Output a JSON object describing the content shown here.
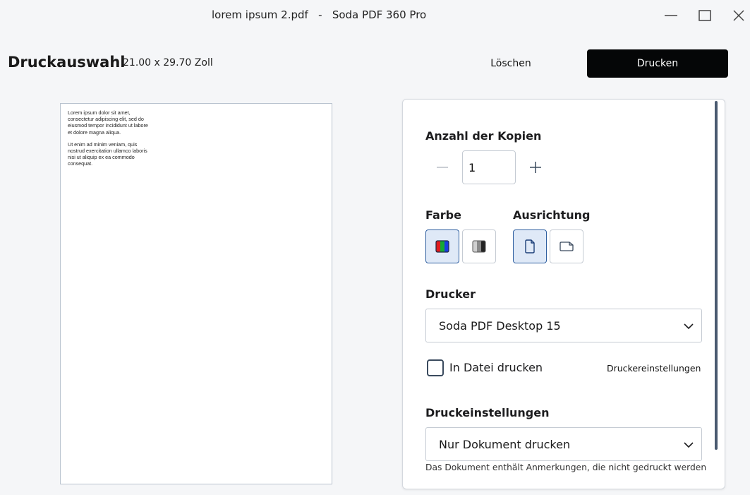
{
  "window": {
    "title": "lorem ipsum 2.pdf   -   Soda PDF 360 Pro",
    "minimize_icon": "minimize-icon",
    "maximize_icon": "maximize-icon",
    "close_icon": "close-icon"
  },
  "header": {
    "title": "Druckauswahl",
    "page_size": "21.00 x 29.70 Zoll",
    "clear_label": "Löschen",
    "print_label": "Drucken"
  },
  "preview": {
    "paragraphs": [
      "Lorem ipsum dolor sit amet, consectetur adipiscing elit, sed do eiusmod tempor incididunt ut labore et dolore magna aliqua.",
      "Ut enim ad minim veniam, quis nostrud exercitation ullamco laboris nisi ut aliquip ex ea commodo consequat."
    ]
  },
  "settings": {
    "copies_label": "Anzahl der Kopien",
    "copies_value": "1",
    "color_label": "Farbe",
    "color_options": [
      {
        "name": "color",
        "icon": "rgb-color-icon",
        "selected": true
      },
      {
        "name": "grayscale",
        "icon": "grayscale-icon",
        "selected": false
      }
    ],
    "orientation_label": "Ausrichtung",
    "orientation_options": [
      {
        "name": "portrait",
        "icon": "portrait-page-icon",
        "selected": true
      },
      {
        "name": "landscape",
        "icon": "landscape-page-icon",
        "selected": false
      }
    ],
    "printer_label": "Drucker",
    "printer_value": "Soda PDF Desktop 15",
    "print_to_file_label": "In Datei drucken",
    "print_to_file_checked": false,
    "printer_settings_link": "Druckereinstellungen",
    "print_settings_label": "Druckeinstellungen",
    "print_settings_value": "Nur Dokument drucken",
    "annotation_hint": "Das Dokument enthält Anmerkungen, die nicht gedruckt werden"
  },
  "colors": {
    "primary_button": "#050607",
    "selected_option_bg": "#dfe9f7",
    "selected_option_border": "#2f5fa0",
    "scrollbar": "#4a5a70"
  }
}
